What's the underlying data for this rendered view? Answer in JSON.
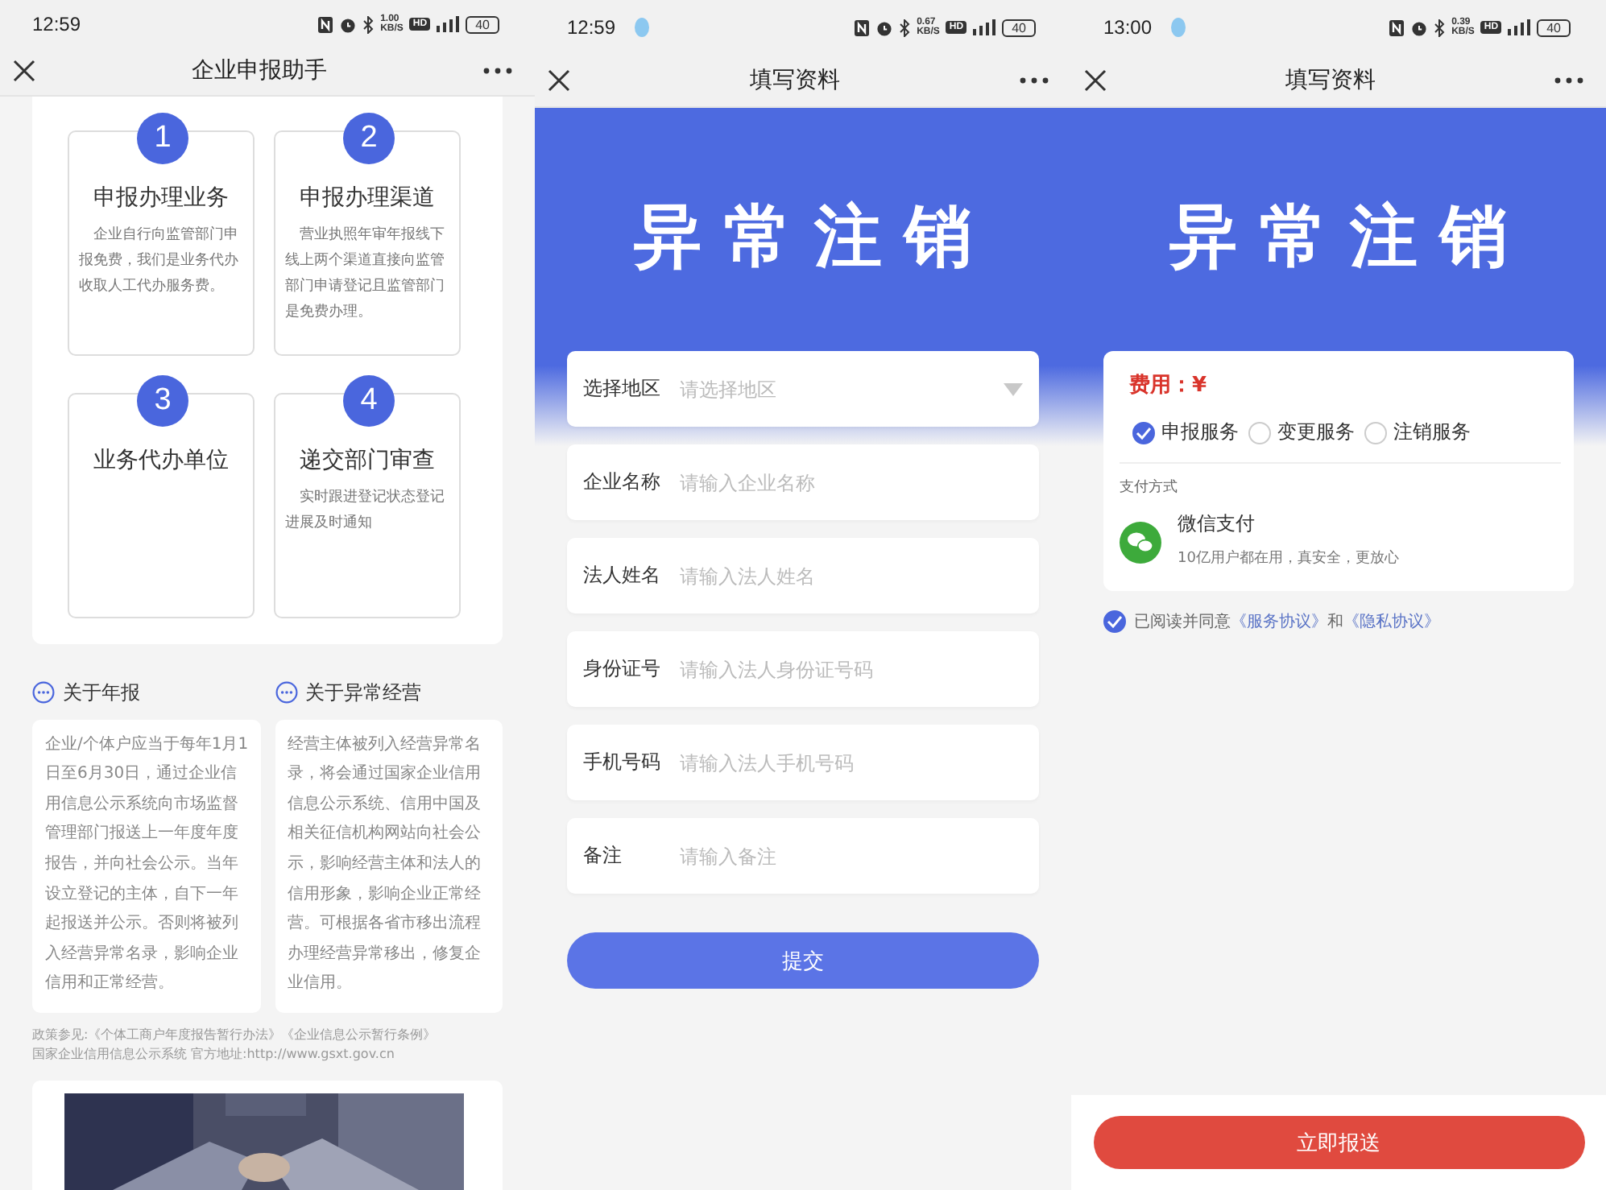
{
  "phones": [
    {
      "kind": "guide",
      "status_bar": {
        "time": "12:59",
        "speed_value": "1.00",
        "speed_unit": "KB/S",
        "hd": "HD",
        "battery": "40"
      },
      "nav": {
        "title": "企业申报助手"
      },
      "steps": [
        {
          "number": "1",
          "title": "申报办理业务",
          "description": "企业自行向监管部门申报免费，我们是业务代办收取人工代办服务费。"
        },
        {
          "number": "2",
          "title": "申报办理渠道",
          "description": "营业执照年审年报线下线上两个渠道直接向监管部门申请登记且监管部门是免费办理。"
        },
        {
          "number": "3",
          "title": "业务代办单位"
        },
        {
          "number": "4",
          "title": "递交部门审查",
          "description": "实时跟进登记状态登记进展及时通知"
        }
      ],
      "info": [
        {
          "heading": "关于年报",
          "body": "企业/个体户应当于每年1月1日至6月30日，通过企业信用信息公示系统向市场监督管理部门报送上一年度年度报告，并向社会公示。当年设立登记的主体，自下一年起报送并公示。否则将被列入经营异常名录，影响企业信用和正常经营。"
        },
        {
          "heading": "关于异常经营",
          "body": "经营主体被列入经营异常名录，将会通过国家企业信用信息公示系统、信用中国及相关征信机构网站向社会公示，影响经营主体和法人的信用形象，影响企业正常经营。可根据各省市移出流程办理经营异常移出，修复企业信用。"
        }
      ],
      "policy": [
        "政策参见:《个体工商户年度报告暂行办法》《企业信息公示暂行条例》",
        "国家企业信用信息公示系统 官方地址:http://www.gsxt.gov.cn"
      ],
      "contact": {
        "kind": "picture"
      }
    },
    {
      "kind": "form",
      "status_bar": {
        "time": "12:59",
        "notification": true,
        "speed_value": "0.67",
        "speed_unit": "KB/S",
        "hd": "HD",
        "battery": "40"
      },
      "nav": {
        "title": "填写资料"
      },
      "banner": "异常注销",
      "fields": [
        {
          "kind": "select",
          "label": "选择地区",
          "placeholder": "请选择地区"
        },
        {
          "kind": "input",
          "label": "企业名称",
          "placeholder": "请输入企业名称"
        },
        {
          "kind": "input",
          "label": "法人姓名",
          "placeholder": "请输入法人姓名"
        },
        {
          "kind": "input",
          "label": "身份证号",
          "placeholder": "请输入法人身份证号码"
        },
        {
          "kind": "input",
          "label": "手机号码",
          "placeholder": "请输入法人手机号码"
        },
        {
          "kind": "input",
          "label": "备注",
          "placeholder": "请输入备注"
        }
      ],
      "submit": "提交"
    },
    {
      "kind": "payment",
      "status_bar": {
        "time": "13:00",
        "notification": true,
        "speed_value": "0.39",
        "speed_unit": "KB/S",
        "hd": "HD",
        "battery": "40"
      },
      "nav": {
        "title": "填写资料"
      },
      "banner": "异常注销",
      "fee": "费用：¥",
      "services": [
        {
          "label": "申报服务",
          "selected": true
        },
        {
          "label": "变更服务",
          "selected": false
        },
        {
          "label": "注销服务",
          "selected": false
        }
      ],
      "pay_heading": "支付方式",
      "pay_method": {
        "name": "微信支付",
        "note": "10亿用户都在用，真安全，更放心"
      },
      "agreement": {
        "checked": true,
        "parts": [
          {
            "kind": "text",
            "text": "已阅读并同意"
          },
          {
            "kind": "link",
            "text": "《服务协议》"
          },
          {
            "kind": "text",
            "text": "和"
          },
          {
            "kind": "link",
            "text": "《隐私协议》"
          }
        ]
      },
      "action": "立即报送"
    }
  ]
}
